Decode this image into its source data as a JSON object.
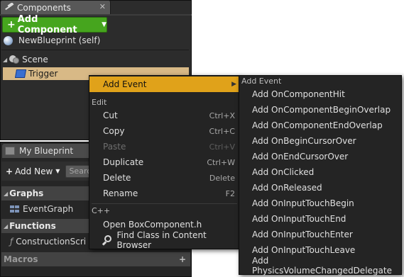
{
  "components_panel": {
    "tab_title": "Components",
    "tab_close_glyph": "✕",
    "add_component_label": "Add Component",
    "self_item": "NewBlueprint (self)",
    "tree": {
      "scene_label": "Scene",
      "trigger_label": "Trigger"
    }
  },
  "blueprint_panel": {
    "tab_title": "My Blueprint",
    "add_new_label": "Add New",
    "search_placeholder": "Search",
    "sections": {
      "graphs_header": "Graphs",
      "event_graph": "EventGraph",
      "functions_header": "Functions",
      "construction_script": "ConstructionScri",
      "macros_header": "Macros"
    }
  },
  "context_menu": {
    "add_event": "Add Event",
    "edit_heading": "Edit",
    "edit_items": [
      {
        "label": "Cut",
        "shortcut": "Ctrl+X"
      },
      {
        "label": "Copy",
        "shortcut": "Ctrl+C"
      },
      {
        "label": "Paste",
        "shortcut": "Ctrl+V",
        "disabled": true
      },
      {
        "label": "Duplicate",
        "shortcut": "Ctrl+W"
      },
      {
        "label": "Delete",
        "shortcut": "Delete"
      },
      {
        "label": "Rename",
        "shortcut": "F2"
      }
    ],
    "cpp_heading": "C++",
    "cpp_items": [
      {
        "label": "Open BoxComponent.h"
      },
      {
        "label": "Find Class in Content Browser"
      }
    ]
  },
  "add_event_submenu": {
    "heading": "Add Event",
    "items": [
      "Add OnComponentHit",
      "Add OnComponentBeginOverlap",
      "Add OnComponentEndOverlap",
      "Add OnBeginCursorOver",
      "Add OnEndCursorOver",
      "Add OnClicked",
      "Add OnReleased",
      "Add OnInputTouchBegin",
      "Add OnInputTouchEnd",
      "Add OnInputTouchEnter",
      "Add OnInputTouchLeave",
      "Add PhysicsVolumeChangedDelegate"
    ]
  },
  "colors": {
    "add_component_green": "#46a51e",
    "selection_tan": "#d8b986",
    "menu_highlight": "#e0a21a",
    "panel_dark": "#2c2c2c"
  }
}
